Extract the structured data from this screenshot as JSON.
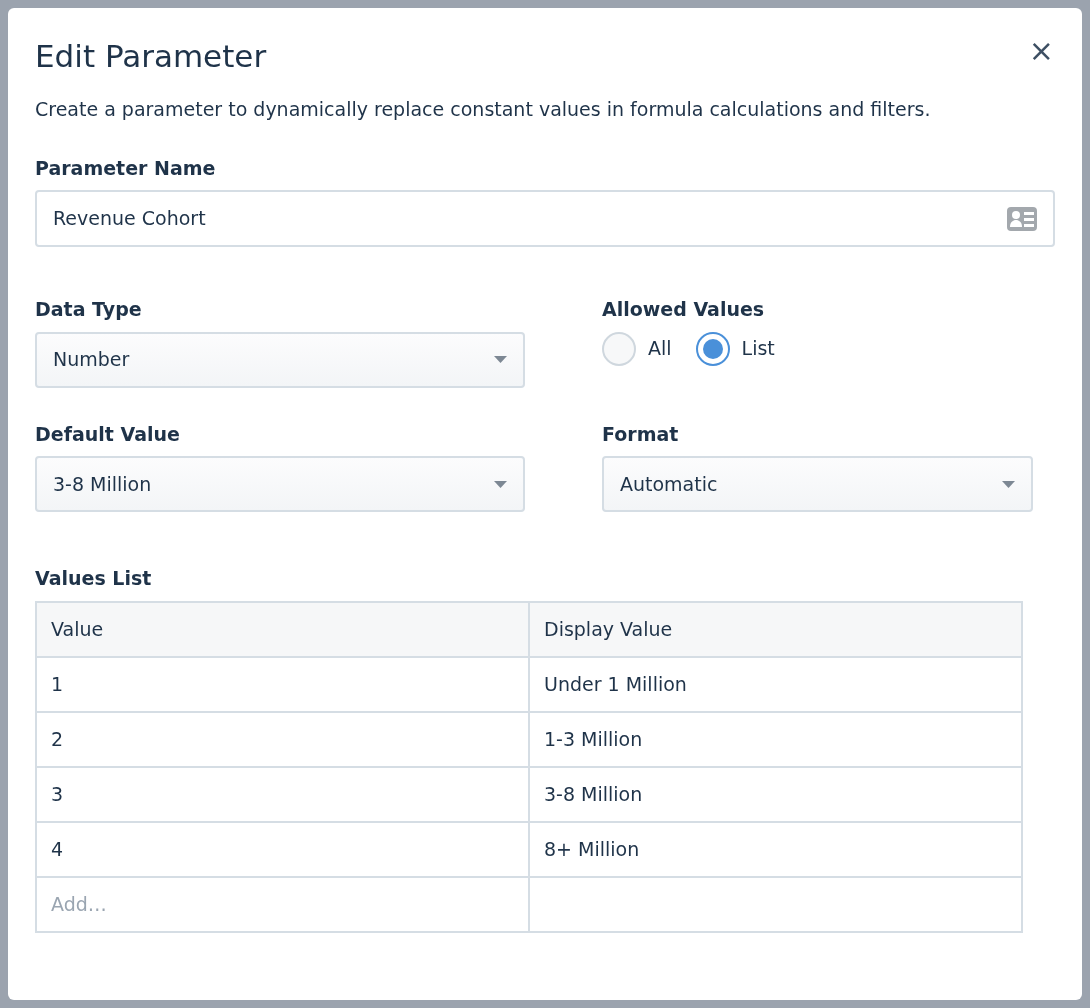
{
  "dialog": {
    "title": "Edit Parameter",
    "close": "×",
    "description": "Create a parameter to dynamically replace constant values in formula calculations and filters."
  },
  "parameter_name": {
    "label": "Parameter Name",
    "value": "Revenue Cohort"
  },
  "data_type": {
    "label": "Data Type",
    "value": "Number"
  },
  "allowed_values": {
    "label": "Allowed Values",
    "options": [
      {
        "label": "All",
        "selected": false
      },
      {
        "label": "List",
        "selected": true
      }
    ]
  },
  "default_value": {
    "label": "Default Value",
    "value": "3-8 Million"
  },
  "format": {
    "label": "Format",
    "value": "Automatic"
  },
  "values_list": {
    "label": "Values List",
    "columns": [
      "Value",
      "Display Value"
    ],
    "rows": [
      [
        "1",
        "Under 1 Million"
      ],
      [
        "2",
        "1-3 Million"
      ],
      [
        "3",
        "3-8 Million"
      ],
      [
        "4",
        "8+ Million"
      ]
    ],
    "add_placeholder": "Add…"
  }
}
